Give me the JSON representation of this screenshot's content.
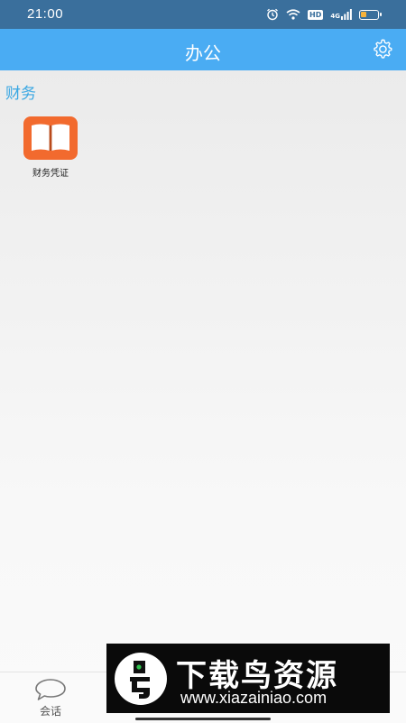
{
  "status_bar": {
    "time": "21:00",
    "icons": [
      "alarm-icon",
      "wifi-icon",
      "hd-icon",
      "signal-icon",
      "battery-icon"
    ],
    "hd_label": "HD",
    "signal_label": "4G",
    "battery_level": 0.35,
    "battery_color": "#f7b23b"
  },
  "header": {
    "title": "办公",
    "settings_icon": "gear-icon"
  },
  "sections": [
    {
      "title": "财务",
      "apps": [
        {
          "label": "财务凭证",
          "icon": "book-icon",
          "icon_color": "#f26a2e"
        }
      ]
    }
  ],
  "bottom_nav": {
    "items": [
      {
        "label": "会话",
        "icon": "chat-bubble-icon"
      }
    ]
  },
  "watermark": {
    "title": "下载鸟资源",
    "url": "www.xiazainiao.com"
  },
  "colors": {
    "status_bar": "#3a6f9c",
    "header": "#4aacf3",
    "section_title": "#39a7e3"
  }
}
